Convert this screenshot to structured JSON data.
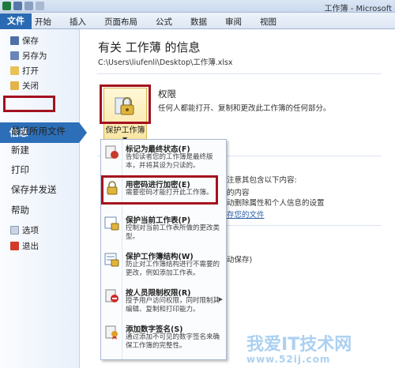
{
  "window": {
    "title": "工作簿 - Microsoft"
  },
  "ribbon": {
    "file_tab": "文件",
    "tabs": [
      "开始",
      "插入",
      "页面布局",
      "公式",
      "数据",
      "审阅",
      "视图"
    ]
  },
  "sidebar": {
    "save": "保存",
    "save_as": "另存为",
    "open": "打开",
    "close": "关闭",
    "info": "信息",
    "recent": "最近所用文件",
    "new": "新建",
    "print": "打印",
    "save_send": "保存并发送",
    "help": "帮助",
    "options": "选项",
    "exit": "退出"
  },
  "main": {
    "title": "有关 工作薄 的信息",
    "path": "C:\\Users\\liufenli\\Desktop\\工作薄.xlsx",
    "permissions": {
      "heading": "权限",
      "description": "任何人都能打开、复制和更改此工作簿的任何部分。",
      "button_label": "保护工作簿"
    },
    "background": {
      "line1": "注意其包含以下内容:",
      "line2": "的内容",
      "line3": "动删除属性和个人信息的设置",
      "link": "存您的文件",
      "line4": "动保存)"
    }
  },
  "dropdown": {
    "items": [
      {
        "title": "标记为最终状态(F)",
        "desc": "告知读者您的工作簿是最终版本，并将其设为只读的。"
      },
      {
        "title": "用密码进行加密(E)",
        "desc": "需要密码才能打开此工作簿。"
      },
      {
        "title": "保护当前工作表(P)",
        "desc": "控制对当前工作表所做的更改类型。"
      },
      {
        "title": "保护工作簿结构(W)",
        "desc": "防止对工作簿结构进行不需要的更改，例如添加工作表。"
      },
      {
        "title": "按人员限制权限(R)",
        "desc": "授予用户访问权限，同时限制其编辑、复制和打印能力。"
      },
      {
        "title": "添加数字签名(S)",
        "desc": "通过添加不可见的数字签名来确保工作簿的完整性。"
      }
    ]
  },
  "watermark": {
    "main": "我爱IT技术网",
    "sub": "www.52ij.com"
  },
  "colors": {
    "accent": "#2c6fb8",
    "highlight_box": "#a3121f"
  }
}
